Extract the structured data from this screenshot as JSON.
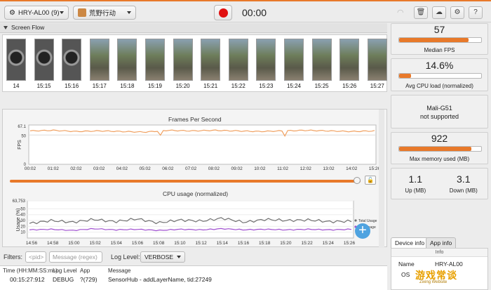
{
  "toolbar": {
    "device": "HRY-AL00 (9)",
    "app": "荒野行动",
    "timer": "00:00"
  },
  "screen_flow": {
    "title": "Screen Flow",
    "timestamps": [
      "14",
      "15:15",
      "15:16",
      "15:17",
      "15:18",
      "15:19",
      "15:20",
      "15:21",
      "15:22",
      "15:23",
      "15:24",
      "15:25",
      "15:26",
      "15:27"
    ]
  },
  "fps_chart": {
    "title": "Frames Per Second",
    "ylabel": "FPS",
    "ymax_label": "67.1",
    "ymid_label": "50",
    "yzero_label": "0",
    "xticks": [
      "00:02",
      "01:02",
      "02:02",
      "03:02",
      "04:02",
      "05:02",
      "06:02",
      "07:02",
      "08:02",
      "09:02",
      "10:02",
      "11:02",
      "12:02",
      "13:02",
      "14:02",
      "15:26"
    ]
  },
  "cpu_chart": {
    "title": "CPU usage (normalized)",
    "ylabel": "Usage (%)",
    "yticks": [
      "63,753",
      "50",
      "40",
      "30",
      "20",
      "10"
    ],
    "xticks": [
      "14:56",
      "14:58",
      "15:00",
      "15:02",
      "15:04",
      "15:06",
      "15:08",
      "15:10",
      "15:12",
      "15:14",
      "15:16",
      "15:18",
      "15:20",
      "15:22",
      "15:24",
      "15:26"
    ],
    "legend_total": "Total Usage",
    "legend_app": "App Usage"
  },
  "chart_data": [
    {
      "type": "line",
      "title": "Frames Per Second",
      "ylabel": "FPS",
      "ylim": [
        0,
        67.1
      ],
      "x": [
        "00:02",
        "01:02",
        "02:02",
        "03:02",
        "04:02",
        "05:02",
        "06:02",
        "07:02",
        "08:02",
        "09:02",
        "10:02",
        "11:02",
        "12:02",
        "13:02",
        "14:02",
        "15:26"
      ],
      "series": [
        {
          "name": "FPS",
          "values": [
            57,
            58,
            56,
            57,
            56,
            55,
            58,
            57,
            58,
            57,
            56,
            57,
            58,
            57,
            56,
            57
          ]
        }
      ]
    },
    {
      "type": "line",
      "title": "CPU usage (normalized)",
      "ylabel": "Usage (%)",
      "x": [
        "14:56",
        "14:58",
        "15:00",
        "15:02",
        "15:04",
        "15:06",
        "15:08",
        "15:10",
        "15:12",
        "15:14",
        "15:16",
        "15:18",
        "15:20",
        "15:22",
        "15:24",
        "15:26"
      ],
      "series": [
        {
          "name": "Total Usage",
          "values": [
            25,
            30,
            27,
            32,
            28,
            33,
            26,
            31,
            29,
            34,
            27,
            32,
            30,
            31,
            28,
            29
          ]
        },
        {
          "name": "App Usage",
          "values": [
            14,
            15,
            13,
            16,
            14,
            15,
            13,
            15,
            14,
            16,
            14,
            15,
            14,
            15,
            14,
            15
          ]
        }
      ]
    }
  ],
  "filters": {
    "label": "Filters:",
    "pid_placeholder": "<pid>",
    "message_placeholder": "Message (regex)",
    "log_level_label": "Log Level:",
    "log_level_value": "VERBOSE"
  },
  "log": {
    "headers": [
      "Time (HH:MM:SS:ms)",
      "Log Level",
      "App",
      "Message"
    ],
    "row": [
      "00:15:27:912",
      "DEBUG",
      "?(729)",
      "SensorHub - addLayerName, tid:27249"
    ]
  },
  "stats": {
    "median_fps": "57",
    "median_fps_label": "Median FPS",
    "median_fps_fraction": 0.85,
    "cpu_load": "14.6%",
    "cpu_load_label": "Avg CPU load (normalized)",
    "cpu_load_fraction": 0.146,
    "gpu_name": "Mali-G51",
    "gpu_status": "not supported",
    "max_memory": "922",
    "max_memory_label": "Max memory used (MB)",
    "max_memory_fraction": 0.88,
    "up_value": "1.1",
    "up_label": "Up (MB)",
    "down_value": "3.1",
    "down_label": "Down (MB)"
  },
  "device_info": {
    "tab_device": "Device info",
    "tab_app": "App info",
    "header": "Info",
    "name_label": "Name",
    "name_value": "HRY-AL00",
    "os_label": "OS"
  },
  "watermark": {
    "text": "游戏常谈",
    "sub": "Zixing Website"
  },
  "colors": {
    "accent": "#e8792a",
    "record": "#e01010",
    "fps_line": "#f0a060",
    "total_usage": "#707070",
    "app_usage": "#a050d0"
  }
}
